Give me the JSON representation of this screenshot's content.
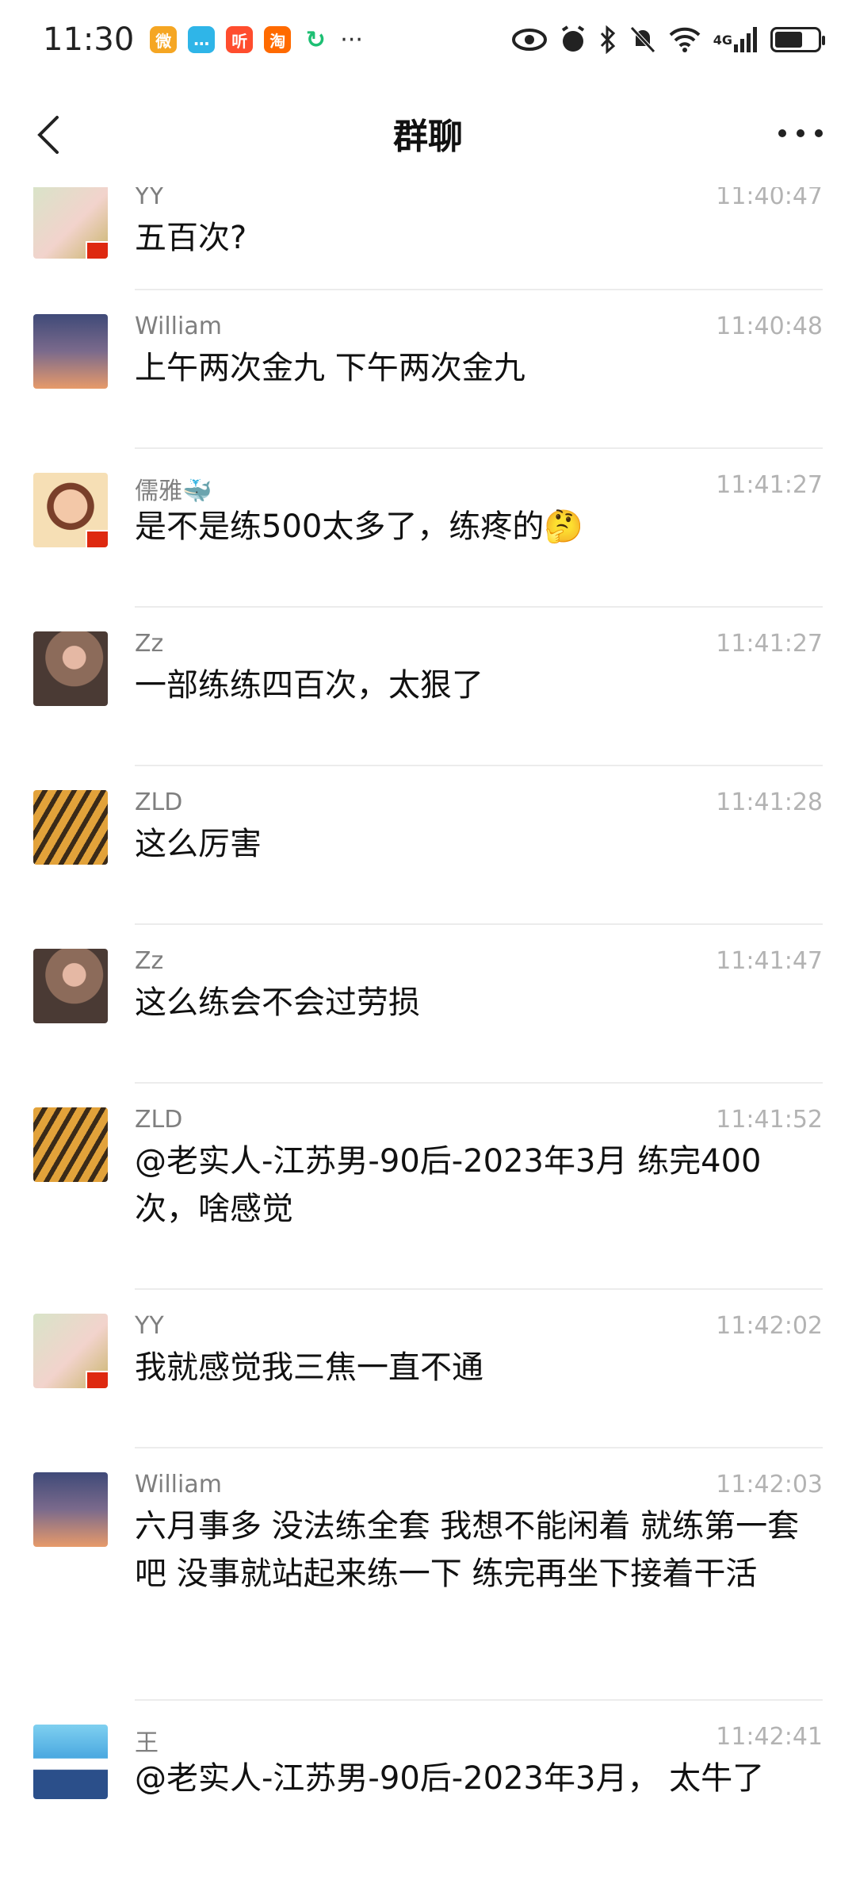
{
  "status": {
    "time": "11:30",
    "apps": [
      {
        "icon": "weibo-icon",
        "color": "#f5a623",
        "glyph": "微"
      },
      {
        "icon": "chat-bubble-icon",
        "color": "#2fb5e8",
        "glyph": "…"
      },
      {
        "icon": "ting-icon",
        "color": "#ff4d2e",
        "glyph": "听"
      },
      {
        "icon": "taobao-icon",
        "color": "#ff6a00",
        "glyph": "淘"
      },
      {
        "icon": "sync-icon",
        "color": "#1dbf73",
        "glyph": "↻"
      }
    ],
    "more": "···",
    "network": "4G"
  },
  "nav": {
    "title": "群聊"
  },
  "messages": [
    {
      "name": "YY",
      "time": "11:40:47",
      "text": "五百次?",
      "avatar": "flower-bird-avatar"
    },
    {
      "name": "William",
      "time": "11:40:48",
      "text": "上午两次金九 下午两次金九",
      "avatar": "sky-sunset-avatar"
    },
    {
      "name": "儒雅🐳",
      "time": "11:41:27",
      "text": "是不是练500太多了，练疼的🤔",
      "avatar": "woman-portrait-avatar"
    },
    {
      "name": "Zz",
      "time": "11:41:27",
      "text": "一部练练四百次，太狠了",
      "avatar": "monk-avatar"
    },
    {
      "name": "ZLD",
      "time": "11:41:28",
      "text": "这么厉害",
      "avatar": "tiger-avatar"
    },
    {
      "name": "Zz",
      "time": "11:41:47",
      "text": "这么练会不会过劳损",
      "avatar": "monk-avatar"
    },
    {
      "name": "ZLD",
      "time": "11:41:52",
      "text": "@老实人-江苏男-90后-2023年3月 练完400次，啥感觉",
      "avatar": "tiger-avatar"
    },
    {
      "name": "YY",
      "time": "11:42:02",
      "text": "我就感觉我三焦一直不通",
      "avatar": "flower-bird-avatar"
    },
    {
      "name": "William",
      "time": "11:42:03",
      "text": "六月事多 没法练全套 我想不能闲着 就练第一套吧 没事就站起来练一下 练完再坐下接着干活",
      "avatar": "sky-sunset-avatar"
    },
    {
      "name": "王",
      "time": "11:42:41",
      "text": "@老实人-江苏男-90后-2023年3月， 太牛了",
      "avatar": "man-blue-avatar"
    }
  ]
}
